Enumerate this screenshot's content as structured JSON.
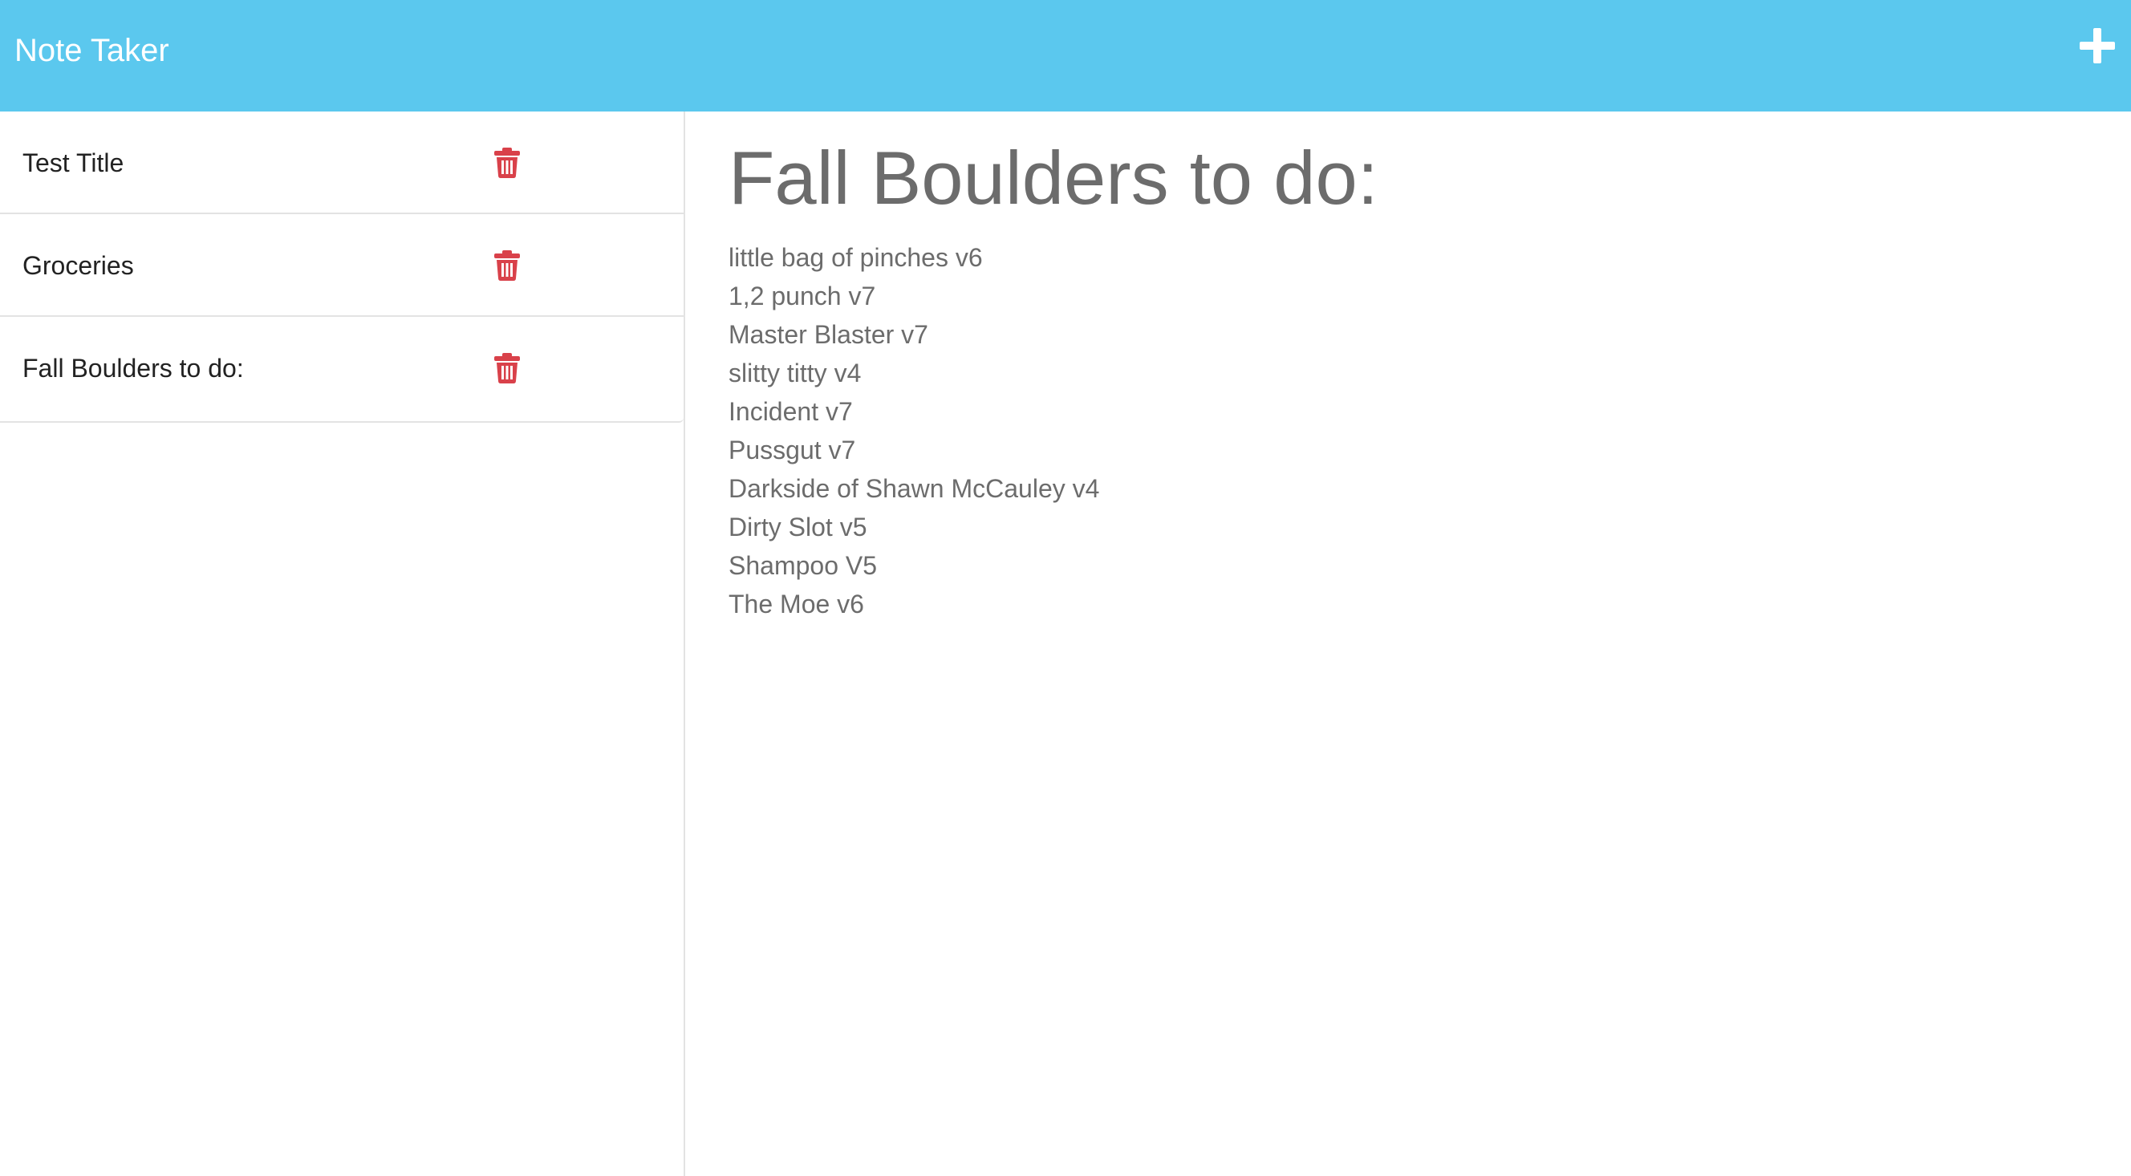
{
  "app": {
    "title": "Note Taker"
  },
  "colors": {
    "navbar": "#5bc8ee",
    "delete_icon": "#d9414a",
    "text_dark": "#222222",
    "text_muted": "#6c6c6c"
  },
  "icons": {
    "add": "plus-icon",
    "delete": "trash-icon"
  },
  "notes": [
    {
      "title": "Test Title"
    },
    {
      "title": "Groceries"
    },
    {
      "title": "Fall Boulders to do:"
    }
  ],
  "active_note": {
    "title": "Fall Boulders to do:",
    "lines": [
      "little bag of pinches v6",
      "1,2 punch v7",
      "Master Blaster v7",
      "slitty titty v4",
      "Incident v7",
      "Pussgut v7",
      "Darkside of Shawn McCauley v4",
      "Dirty Slot v5",
      "Shampoo V5",
      "The Moe v6"
    ]
  }
}
